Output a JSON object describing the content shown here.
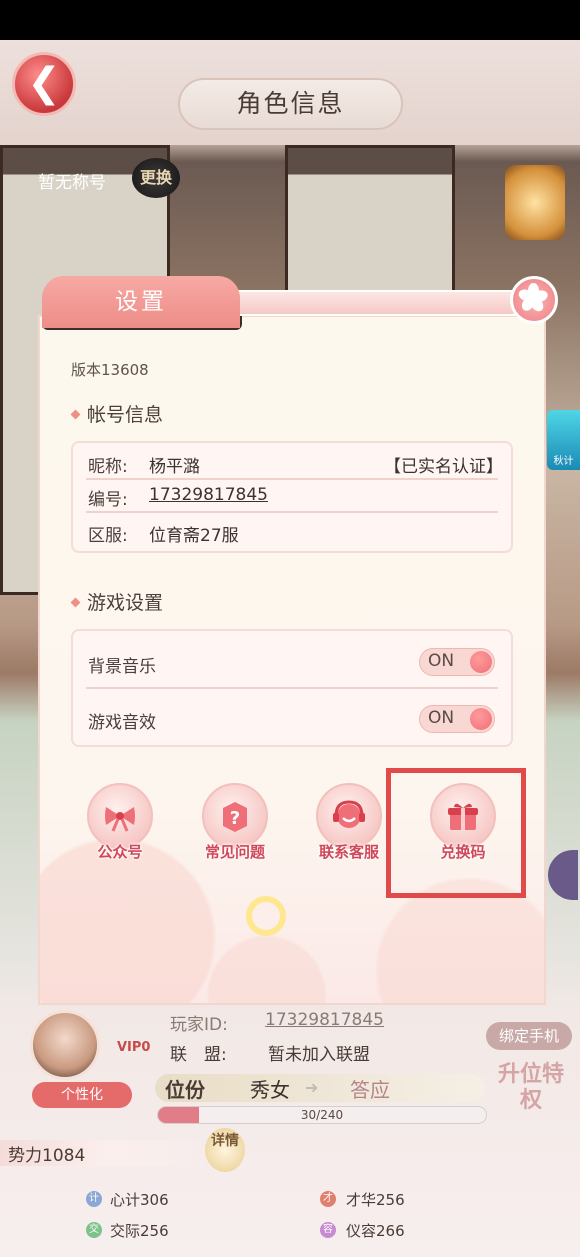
{
  "header": {
    "title": "角色信息",
    "back_icon": "back-arrow-icon"
  },
  "profile_top": {
    "title_label": "暂无称号",
    "change_button": "更换"
  },
  "settings_dialog": {
    "tab_label": "设置",
    "version": "版本13608",
    "account_section": {
      "title": "帐号信息",
      "nickname_label": "昵称:",
      "nickname_value": "杨平潞",
      "verification_status": "【已实名认证】",
      "id_label": "编号:",
      "id_value": "17329817845",
      "server_label": "区服:",
      "server_value": "位育斋27服"
    },
    "game_section": {
      "title": "游戏设置",
      "bgm_label": "背景音乐",
      "bgm_state": "ON",
      "sfx_label": "游戏音效",
      "sfx_state": "ON"
    },
    "shortcuts": [
      {
        "label": "公众号",
        "icon": "bow-icon"
      },
      {
        "label": "常见问题",
        "icon": "question-box-icon"
      },
      {
        "label": "联系客服",
        "icon": "headset-icon"
      },
      {
        "label": "兑换码",
        "icon": "gift-icon"
      }
    ]
  },
  "player_info": {
    "id_label": "玩家ID:",
    "id_value": "17329817845",
    "alliance_label": "联　盟:",
    "alliance_value": "暂未加入联盟",
    "vip": "VIP0",
    "bind_phone_button": "绑定手机",
    "personalize_button": "个性化",
    "rank_label": "位份",
    "rank_current": "秀女",
    "rank_next": "答应",
    "rank_progress_text": "30/240",
    "rank_progress_fraction": 0.125,
    "promote_button": "升位特权",
    "power": "势力1084",
    "details_button": "详情",
    "stats": [
      {
        "icon_char": "计",
        "text": "心计306",
        "color": "#8aa7d6"
      },
      {
        "icon_char": "才",
        "text": "才华256",
        "color": "#e07f6e"
      },
      {
        "icon_char": "交",
        "text": "交际256",
        "color": "#7cc28a"
      },
      {
        "icon_char": "容",
        "text": "仪容266",
        "color": "#c58ad0"
      }
    ]
  },
  "side": {
    "event_label": "秋计"
  }
}
